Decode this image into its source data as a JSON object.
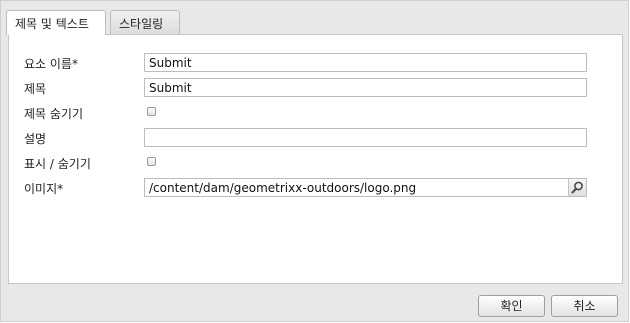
{
  "tabs": [
    {
      "label": "제목 및 텍스트",
      "active": true
    },
    {
      "label": "스타일링",
      "active": false
    }
  ],
  "form": {
    "element_name": {
      "label": "요소 이름*",
      "value": "Submit"
    },
    "title": {
      "label": "제목",
      "value": "Submit"
    },
    "hide_title": {
      "label": "제목 숨기기",
      "checked": false
    },
    "description": {
      "label": "설명",
      "value": ""
    },
    "show_hide": {
      "label": "표시 / 숨기기",
      "checked": false
    },
    "image": {
      "label": "이미지*",
      "value": "/content/dam/geometrixx-outdoors/logo.png"
    }
  },
  "footer": {
    "ok_label": "확인",
    "cancel_label": "취소"
  },
  "icons": {
    "image_browse": "search-icon"
  }
}
